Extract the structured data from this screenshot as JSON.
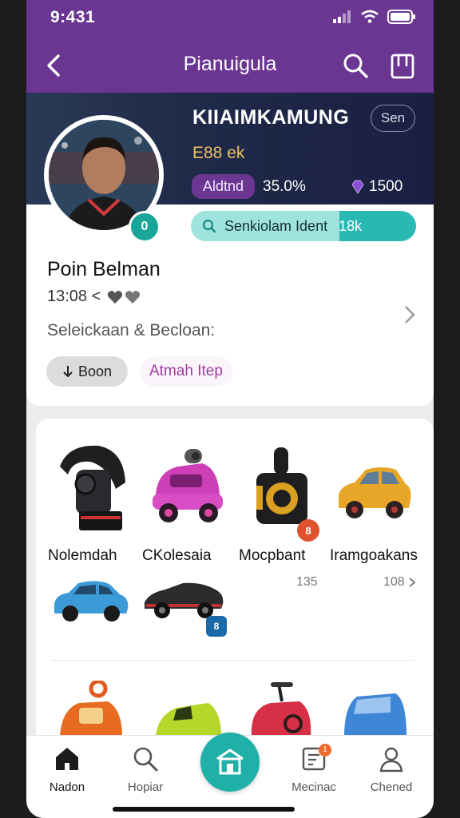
{
  "status_bar": {
    "time": "9:431"
  },
  "header": {
    "title": "Pianuigula"
  },
  "profile": {
    "banner_name": "KIIAIMKAMUNG",
    "see_label": "Sen",
    "followers": "E88 ek",
    "added_label": "Aldtnd",
    "percent": "35.0%",
    "gem_value": "1500",
    "search_label": "Senkiolam Ident",
    "search_tail": "18k",
    "avatar_badge": "0",
    "name": "Poin Belman",
    "meta": "13:08 <",
    "section_label": "Seleickaan & Becloan:",
    "btn_primary": "Boon",
    "btn_secondary": "Atmah Itep"
  },
  "products": {
    "row1": [
      {
        "label": "Nolemdah"
      },
      {
        "label": "CKolesaia"
      },
      {
        "label": "Mocpbant"
      },
      {
        "label": "Iramgoakans"
      }
    ],
    "count_a": "135",
    "count_b": "108",
    "tag_red": "8",
    "tag_blue": "8"
  },
  "colors": {
    "brand": "#6b3592",
    "accent": "#1fb0a7"
  },
  "nav": {
    "items": [
      {
        "label": "Nadon",
        "icon": "home-icon"
      },
      {
        "label": "Hopiar",
        "icon": "search-icon"
      },
      {
        "label": "",
        "icon": "store-icon"
      },
      {
        "label": "Mecinac",
        "icon": "messages-icon"
      },
      {
        "label": "Chened",
        "icon": "profile-icon"
      }
    ],
    "badge": "1"
  }
}
